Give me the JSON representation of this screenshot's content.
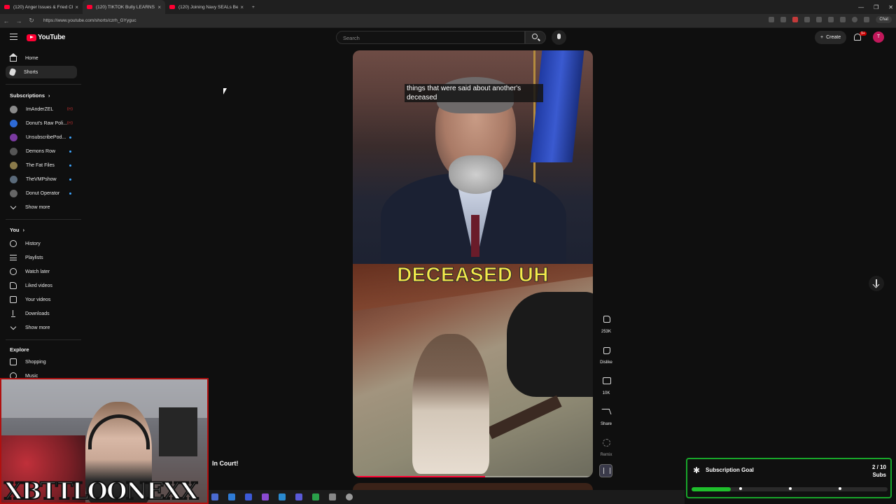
{
  "browser": {
    "tabs": [
      {
        "title": "(120) Anger Issues & Fried Chicke",
        "active": false
      },
      {
        "title": "(120) TIKTOK Bully LEARNS Th",
        "active": true
      },
      {
        "title": "(120) Joining Navy SEALs Becaus",
        "active": false
      }
    ],
    "url": "https://www.youtube.com/shorts/czrh_GYyguc",
    "chat_label": "Chat"
  },
  "header": {
    "logo_text": "YouTube",
    "search_placeholder": "Search",
    "create_label": "Create",
    "notif_count": "9+",
    "avatar_letter": "T"
  },
  "sidebar": {
    "main": [
      {
        "label": "Home",
        "icon": "home-icon",
        "active": false
      },
      {
        "label": "Shorts",
        "icon": "shorts-icon",
        "active": true
      }
    ],
    "subscriptions_title": "Subscriptions",
    "subscriptions": [
      {
        "label": "ImAnderZEL",
        "status": "live",
        "color": "#8a8a8a"
      },
      {
        "label": "Donut's Raw Poli...",
        "status": "live",
        "color": "#2d6ad6"
      },
      {
        "label": "UnsubscribePod...",
        "status": "dot",
        "color": "#7a3aa0"
      },
      {
        "label": "Demons Row",
        "status": "dot",
        "color": "#555555"
      },
      {
        "label": "The Fat Files",
        "status": "dot",
        "color": "#8a7a4a"
      },
      {
        "label": "TheVMPshow",
        "status": "dot",
        "color": "#5a6a7a"
      },
      {
        "label": "Donut Operator",
        "status": "dot",
        "color": "#666666"
      }
    ],
    "show_more_1": "Show more",
    "you_title": "You",
    "you_items": [
      {
        "label": "History",
        "icon": "history-icon"
      },
      {
        "label": "Playlists",
        "icon": "playlists-icon"
      },
      {
        "label": "Watch later",
        "icon": "watch-later-icon"
      },
      {
        "label": "Liked videos",
        "icon": "liked-videos-icon"
      },
      {
        "label": "Your videos",
        "icon": "your-videos-icon"
      },
      {
        "label": "Downloads",
        "icon": "downloads-icon"
      }
    ],
    "show_more_2": "Show more",
    "explore_title": "Explore",
    "explore_items": [
      {
        "label": "Shopping",
        "icon": "shopping-icon"
      },
      {
        "label": "Music",
        "icon": "music-icon"
      }
    ]
  },
  "short": {
    "caption_small": "things that were said about another's deceased",
    "caption_big": "DECEASED UH",
    "progress_fraction": 0.55,
    "actions": {
      "like_count": "253K",
      "dislike_label": "Dislike",
      "comment_count": "10K",
      "share_label": "Share",
      "remix_label": "Remix"
    }
  },
  "stream_overlay": {
    "streamer_name": "XBTTLOONEXX",
    "title_fragment": "In Court!",
    "goal": {
      "title": "Subscription Goal",
      "current": 2,
      "target": 10,
      "count_text": "2 / 10",
      "unit": "Subs",
      "accent": "#1fbf2c"
    }
  }
}
